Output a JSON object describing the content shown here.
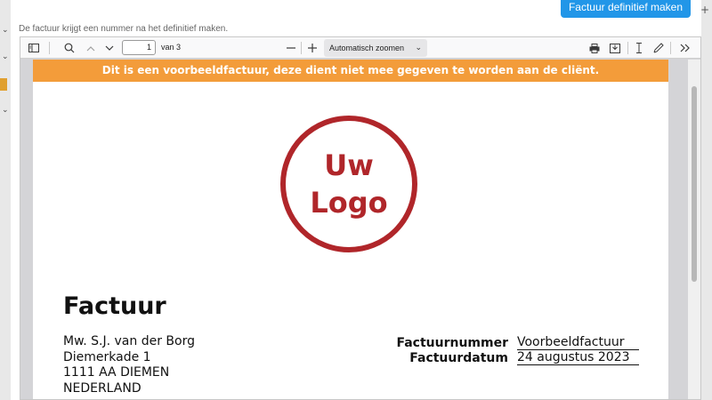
{
  "modal": {
    "hint": "De factuur krijgt een nummer na het definitief maken.",
    "primary_button": "Factuur definitief maken"
  },
  "viewer": {
    "toolbar": {
      "page_number": "1",
      "page_total": "van 3",
      "zoom": "Automatisch zoomen",
      "icons": [
        "sidebar-icon",
        "search-icon",
        "arrow-up-icon",
        "arrow-down-icon",
        "minus-icon",
        "plus-icon",
        "print-icon",
        "download-icon",
        "text-cursor-icon",
        "pen-icon",
        "double-chevron-icon"
      ]
    }
  },
  "document": {
    "banner": "Dit is een voorbeeldfactuur, deze dient niet mee gegeven te worden aan de cliënt.",
    "logo_line1": "Uw",
    "logo_line2": "Logo",
    "title": "Factuur",
    "address": [
      "Mw. S.J. van der Borg",
      "Diemerkade 1",
      "1111 AA  DIEMEN",
      "NEDERLAND"
    ],
    "meta": [
      {
        "label": "Factuurnummer",
        "value": "Voorbeeldfactuur"
      },
      {
        "label": "Factuurdatum",
        "value": "24 augustus 2023"
      }
    ]
  },
  "colors": {
    "primary": "#2196e8",
    "banner": "#f39c3a",
    "logo": "#b0262a"
  }
}
